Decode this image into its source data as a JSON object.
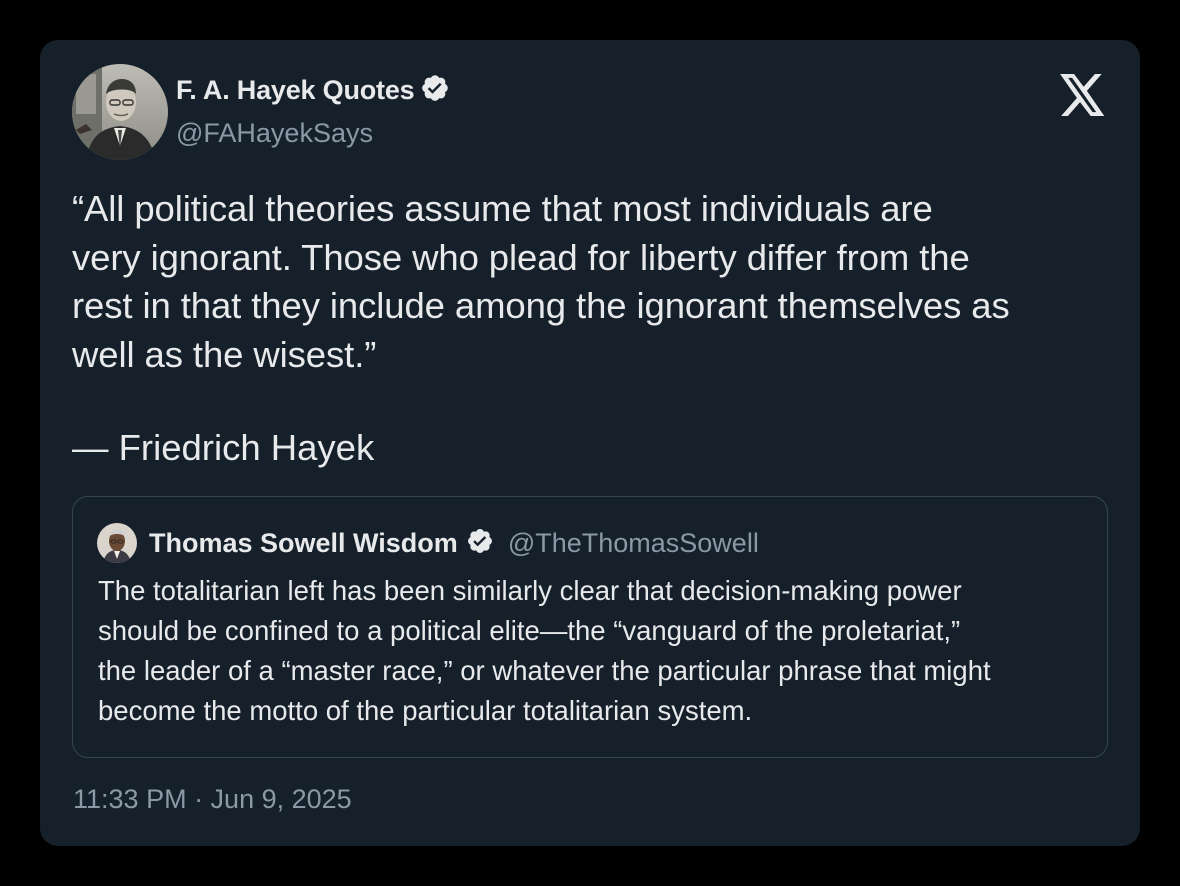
{
  "author": {
    "display_name": "F. A. Hayek Quotes",
    "handle": "@FAHayekSays",
    "avatar_icon": "portrait-avatar",
    "verified": true
  },
  "tweet": {
    "text": "“All political theories assume that most individuals are\nvery ignorant. Those who plead for liberty differ from the\nrest in that they include among the ignorant themselves as\nwell as the wisest.”",
    "attribution": "— Friedrich Hayek"
  },
  "quoted_tweet": {
    "display_name": "Thomas Sowell Wisdom",
    "handle": "@TheThomasSowell",
    "verified": true,
    "text": "The totalitarian left has been similarly clear that decision-making power\nshould be confined to a political elite—the “vanguard of the proletariat,”\nthe leader of a “master race,” or whatever the particular phrase that might\nbecome the motto of the particular totalitarian system."
  },
  "timestamp": "11:33 PM · Jun 9, 2025",
  "icons": {
    "logo": "x-logo-icon",
    "verified": "verified-badge-icon"
  },
  "colors": {
    "background": "#000000",
    "card": "#15202b",
    "text_primary": "#e7e9ea",
    "text_secondary": "#8b98a5",
    "border": "#38444d"
  }
}
